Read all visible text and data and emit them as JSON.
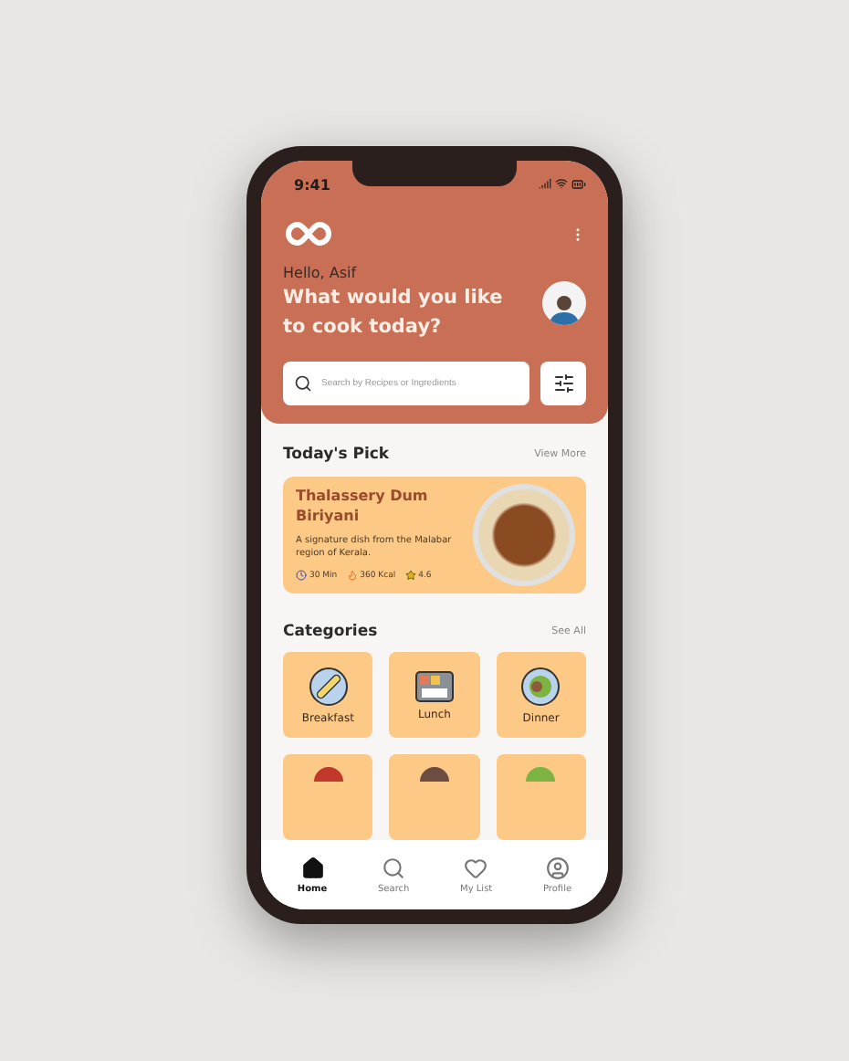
{
  "status_bar": {
    "time": "9:41"
  },
  "header": {
    "greeting": "Hello, Asif",
    "question": "What would you like to cook today?"
  },
  "search": {
    "placeholder": "Search by Recipes or Ingredients"
  },
  "todays_pick": {
    "title": "Today's Pick",
    "link": "View More",
    "dish": {
      "name": "Thalassery Dum Biriyani",
      "description": "A signature dish from the Malabar region of Kerala.",
      "time": "30 Min",
      "calories": "360 Kcal",
      "rating": "4.6"
    }
  },
  "categories": {
    "title": "Categories",
    "link": "See All",
    "items": [
      {
        "label": "Breakfast",
        "kind": "breakfast"
      },
      {
        "label": "Lunch",
        "kind": "lunch"
      },
      {
        "label": "Dinner",
        "kind": "dinner"
      }
    ]
  },
  "tab_bar": [
    {
      "label": "Home",
      "kind": "home",
      "selected": true
    },
    {
      "label": "Search",
      "kind": "search",
      "selected": false
    },
    {
      "label": "My List",
      "kind": "list",
      "selected": false
    },
    {
      "label": "Profile",
      "kind": "profile",
      "selected": false
    }
  ]
}
